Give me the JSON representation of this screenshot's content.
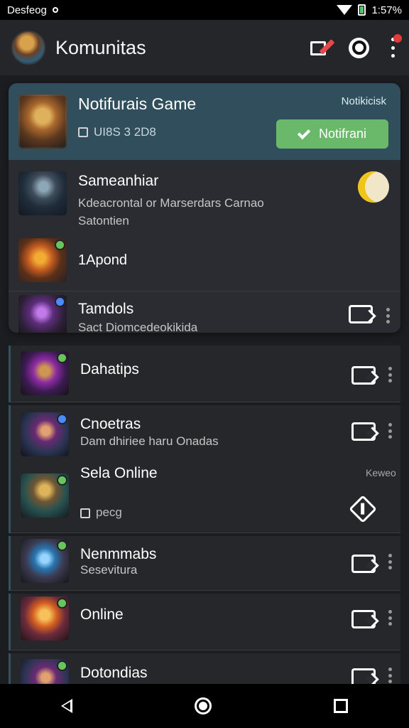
{
  "status_bar": {
    "carrier": "Desfeog",
    "time": "1:57%"
  },
  "header": {
    "title": "Komunitas"
  },
  "featured": {
    "title": "Notifurais Game",
    "subtitle": "UI8S 3 2D8",
    "badge": "Notikicisk",
    "button_label": "Notifrani",
    "items": [
      {
        "title": "Sameanhiar",
        "subtitle_line1": "Kdeacrontal or Marserdars Carnao",
        "subtitle_line2": "Satontien"
      },
      {
        "title": "1Apond"
      },
      {
        "title": "Tamdols",
        "subtitle": "Sact Diomcedeokikida"
      }
    ]
  },
  "list": [
    {
      "title": "Dahatips"
    },
    {
      "title": "Cnoetras",
      "subtitle": "Dam dhiriee haru Onadas"
    },
    {
      "title": "Sela Online",
      "meta": "Keweo",
      "subtitle": "pecg"
    },
    {
      "title": "Nenmmabs",
      "subtitle": "Sesevitura"
    },
    {
      "title": "Online"
    },
    {
      "title": "Dotondias"
    }
  ],
  "icons": {
    "avatar": "avatar",
    "edit": "edit-icon",
    "ring": "ring-icon",
    "more": "more-icon",
    "check": "check-icon",
    "toggle": "toggle-icon",
    "tag": "tag-icon",
    "diamond": "diamond-icon",
    "kebab": "kebab-menu-icon",
    "back": "back-icon",
    "home": "home-icon",
    "recent": "recent-apps-icon"
  },
  "colors": {
    "app_bg": "#1c1d20",
    "header_bg": "#24262a",
    "featured_header_bg": "#304e5b",
    "notify_button": "#6ab86a",
    "badge_red": "#e23b3b"
  }
}
